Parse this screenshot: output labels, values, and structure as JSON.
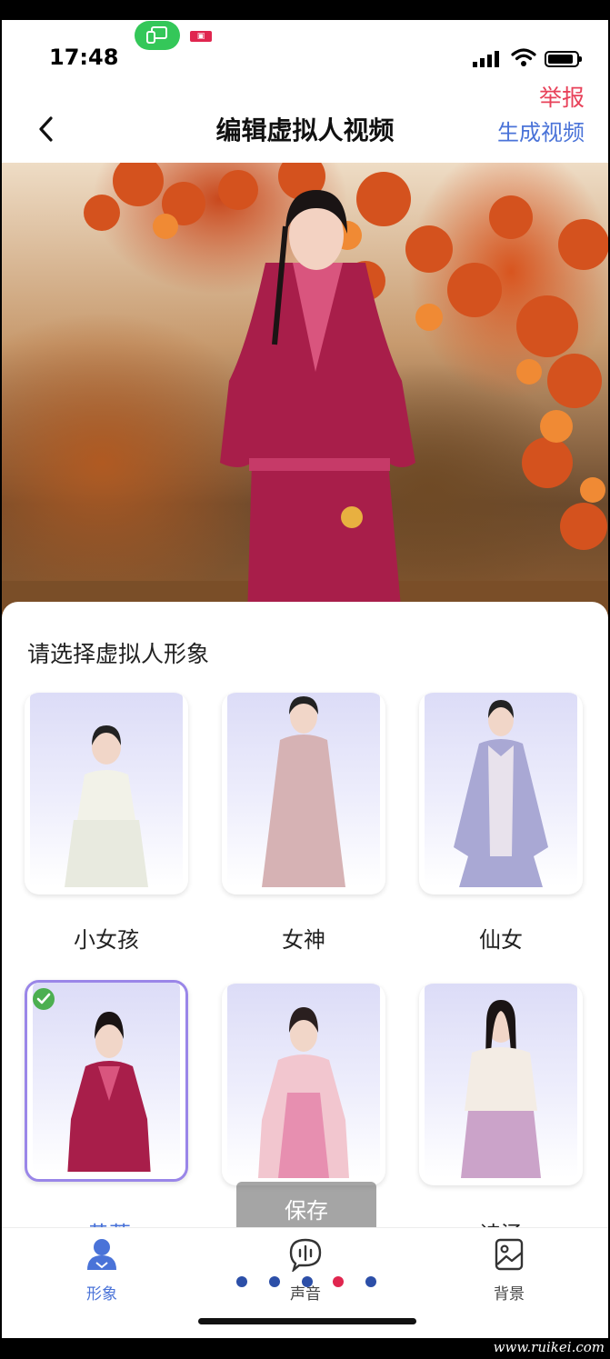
{
  "status_bar": {
    "time": "17:48",
    "cast_color": "#34c759",
    "icons": [
      "screen-cast-icon",
      "record-icon",
      "signal-icon",
      "wifi-icon",
      "battery-icon"
    ]
  },
  "header": {
    "report": "举报",
    "title": "编辑虚拟人视频",
    "generate": "生成视频",
    "back_icon": "chevron-left-icon",
    "report_color": "#e8425a",
    "accent_color": "#4a73d8"
  },
  "sheet": {
    "title": "请选择虚拟人形象",
    "avatars": [
      {
        "label": "小女孩",
        "selected": false
      },
      {
        "label": "女神",
        "selected": false
      },
      {
        "label": "仙女",
        "selected": false
      },
      {
        "label": "黄蓉",
        "selected": true
      },
      {
        "label": "",
        "selected": false
      },
      {
        "label": "诗涵",
        "selected": false
      }
    ]
  },
  "toast": {
    "text": "保存"
  },
  "tabbar": {
    "tabs": [
      {
        "label": "形象",
        "icon": "person-icon",
        "active": true
      },
      {
        "label": "声音",
        "icon": "voice-icon",
        "active": false
      },
      {
        "label": "背景",
        "icon": "image-icon",
        "active": false
      }
    ]
  },
  "pager": {
    "count": 5,
    "active_index": 3
  },
  "watermark": "www.ruikei.com"
}
